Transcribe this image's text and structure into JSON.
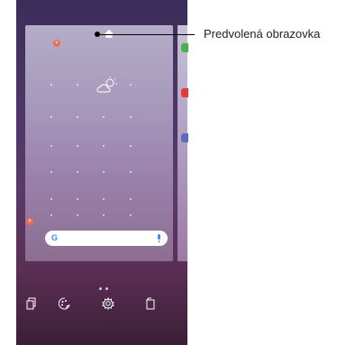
{
  "callout": {
    "label": "Predvolená obrazovka"
  },
  "home_screen": {
    "search_bar": {
      "logo": "G",
      "mic_icon": "microphone-icon"
    },
    "weather_icon": "cloud-sun-icon",
    "remove_badge_icon": "remove-badge-icon",
    "default_page_icon": "home-icon",
    "page_indicator_count": 2
  },
  "bottom_menu": {
    "items": [
      {
        "icon": "widgets-icon",
        "symbol": "⧉"
      },
      {
        "icon": "wallpapers-icon",
        "symbol": "⚙"
      },
      {
        "icon": "settings-icon",
        "symbol": "⚙"
      },
      {
        "icon": "apps-icon",
        "symbol": "⎘"
      }
    ]
  },
  "colors": {
    "badge": "#e86f56",
    "accent": "#4285f4"
  }
}
